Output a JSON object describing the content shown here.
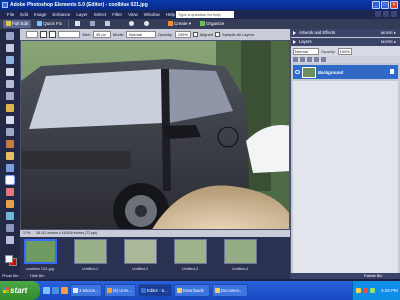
{
  "window": {
    "title": "Adobe Photoshop Elements 5.0 (Editor) - coolblue 021.jpg"
  },
  "menu": {
    "items": [
      "File",
      "Edit",
      "Image",
      "Enhance",
      "Layer",
      "Select",
      "Filter",
      "View",
      "Window",
      "Help"
    ],
    "help_search_placeholder": "Type a question for help"
  },
  "modebar": {
    "full_edit": "Full Edit",
    "quick_fix": "Quick Fix",
    "create": "Create ▾",
    "organize": "Organize"
  },
  "options": {
    "size_label": "Size:",
    "size_value": "45 px",
    "mode_label": "Mode:",
    "mode_value": "Normal",
    "opacity_label": "Opacity:",
    "opacity_value": "100%",
    "aligned_label": "Aligned",
    "sample_all_label": "Sample All Layers"
  },
  "document": {
    "zoom": "17%",
    "info": "28.111 inches x 18.639 inches (72 ppi)"
  },
  "project_bin": {
    "items": [
      {
        "caption": "coolblue 021.jpg",
        "active": true
      },
      {
        "caption": "Untitled-1",
        "active": false
      },
      {
        "caption": "Untitled-2",
        "active": false
      },
      {
        "caption": "Untitled-3",
        "active": false
      },
      {
        "caption": "Untitled-4",
        "active": false
      }
    ],
    "status": "Photo Bin",
    "hide_label": "Hide Bin"
  },
  "palettes": {
    "artwork_effects": "Artwork and Effects",
    "layers": "Layers",
    "more": "MORE ▸",
    "blend_mode": "Normal",
    "opacity_label": "Opacity:",
    "opacity_value": "100%",
    "layer_name": "Background",
    "palette_bin": "Palette Bin"
  },
  "taskbar": {
    "start": "start",
    "tasks": [
      {
        "label": "3 Micros...",
        "active": false
      },
      {
        "label": "(6) Unre...",
        "active": false
      },
      {
        "label": "Editor - 5...",
        "active": true
      },
      {
        "label": "Downloads",
        "active": false
      },
      {
        "label": "Documen...",
        "active": false
      }
    ],
    "clock": "3:28 PM"
  },
  "colors": {
    "foreground": "#ffffff",
    "background": "#e00000",
    "selected_layer": "#3169c6"
  }
}
